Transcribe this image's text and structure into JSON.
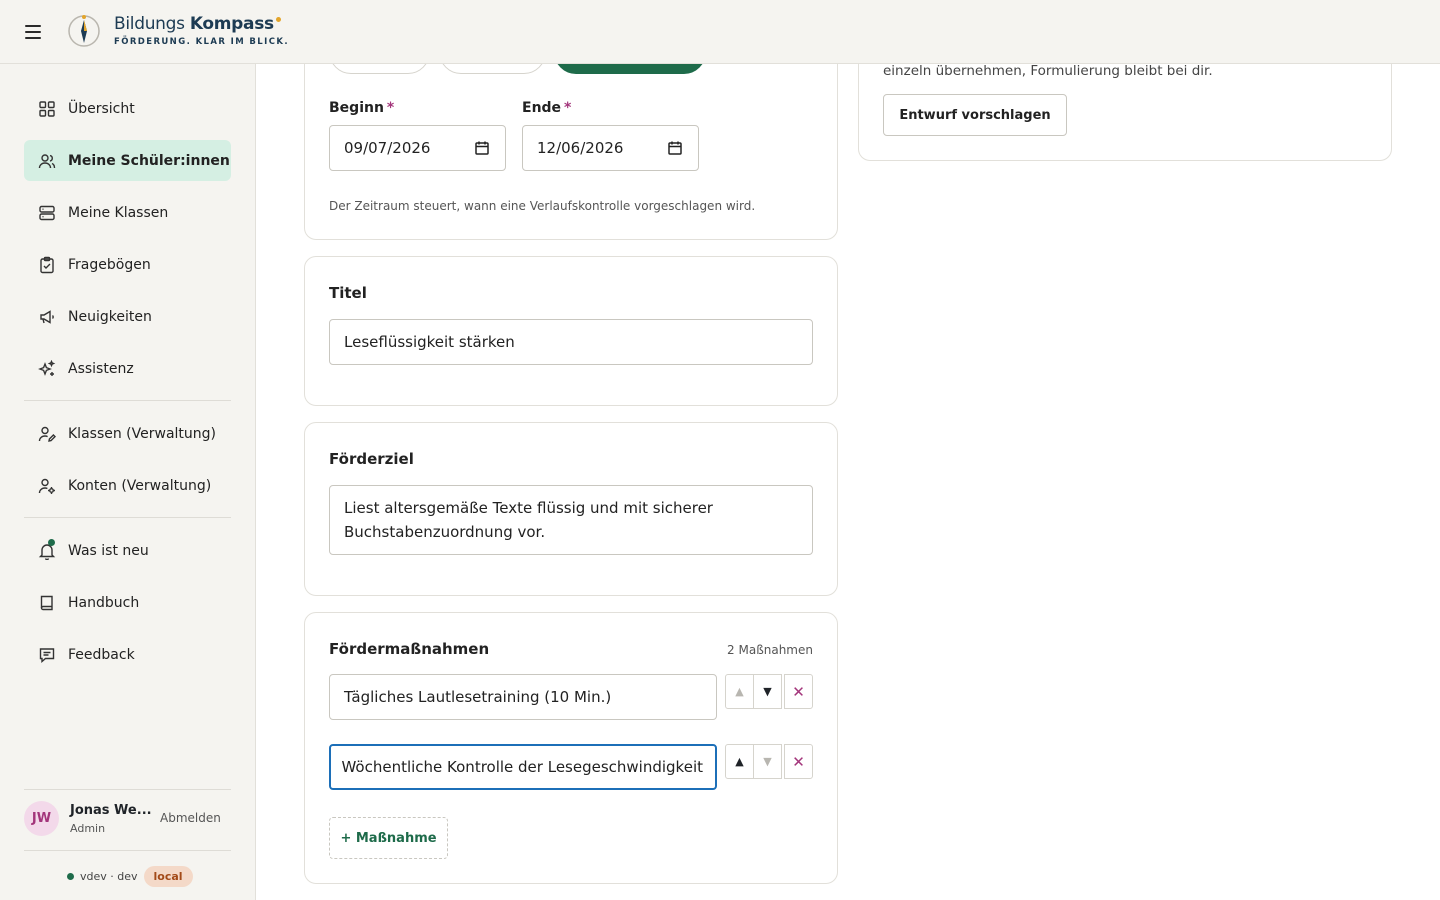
{
  "header": {
    "brand_light": "Bildungs",
    "brand_bold": "Kompass",
    "tagline": "FÖRDERUNG. KLAR IM BLICK.",
    "logo_icon": "compass-icon",
    "menu_icon": "hamburger-icon"
  },
  "sidebar": {
    "items": [
      {
        "label": "Übersicht",
        "icon": "grid-icon",
        "active": false
      },
      {
        "label": "Meine Schüler:innen",
        "icon": "users-icon",
        "active": true
      },
      {
        "label": "Meine Klassen",
        "icon": "stack-icon",
        "active": false
      },
      {
        "label": "Fragebögen",
        "icon": "clipboard-icon",
        "active": false
      },
      {
        "label": "Neuigkeiten",
        "icon": "megaphone-icon",
        "active": false
      },
      {
        "label": "Assistenz",
        "icon": "sparkles-icon",
        "active": false
      },
      {
        "label": "Klassen (Verwaltung)",
        "icon": "user-edit-icon",
        "active": false
      },
      {
        "label": "Konten (Verwaltung)",
        "icon": "user-cog-icon",
        "active": false
      },
      {
        "label": "Was ist neu",
        "icon": "bell-icon",
        "active": false
      },
      {
        "label": "Handbuch",
        "icon": "book-icon",
        "active": false
      },
      {
        "label": "Feedback",
        "icon": "message-icon",
        "active": false
      }
    ],
    "user": {
      "initials": "JW",
      "name": "Jonas We...",
      "role": "Admin",
      "logout": "Abmelden"
    },
    "version": {
      "text": "vdev · dev",
      "env": "local"
    }
  },
  "period": {
    "begin_label": "Beginn",
    "begin_value": "09/07/2026",
    "end_label": "Ende",
    "end_value": "12/06/2026",
    "required_mark": "*",
    "hint": "Der Zeitraum steuert, wann eine Verlaufskontrolle vorgeschlagen wird."
  },
  "title_card": {
    "label": "Titel",
    "value": "Leseflüssigkeit stärken"
  },
  "goal_card": {
    "label": "Förderziel",
    "value": "Liest altersgemäße Texte flüssig und mit sicherer Buchstabenzuordnung vor."
  },
  "measures_card": {
    "label": "Fördermaßnahmen",
    "count": "2 Maßnahmen",
    "items": [
      {
        "value": "Tägliches Lautlesetraining (10 Min.)"
      },
      {
        "value": "Wöchentliche Kontrolle der Lesegeschwindigkeit"
      }
    ],
    "up_glyph": "▲",
    "down_glyph": "▼",
    "delete_glyph": "✕",
    "add_label": "+ Maßnahme"
  },
  "assist_card": {
    "text": "einzeln übernehmen, Formulierung bleibt bei dir.",
    "button": "Entwurf vorschlagen"
  },
  "colors": {
    "accent": "#1e6b4a",
    "active_bg": "#d5efe3",
    "required": "#a3357b",
    "focus": "#1c6fb8"
  }
}
